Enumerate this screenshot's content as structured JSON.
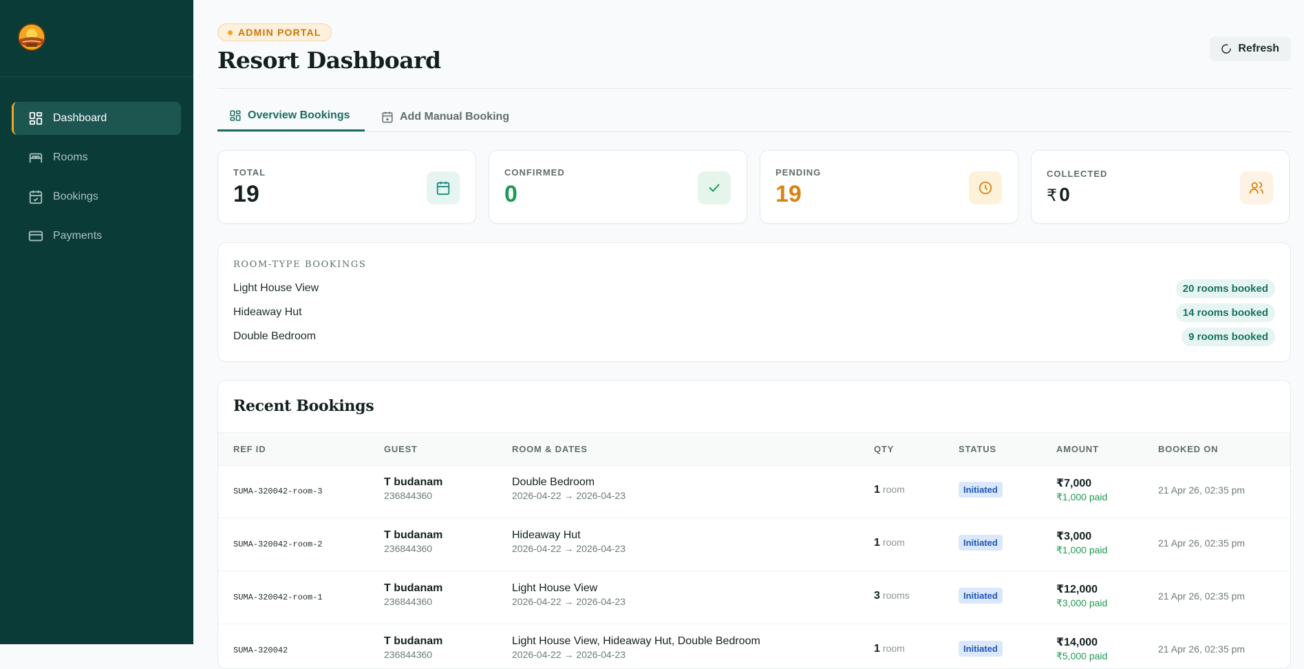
{
  "sidebar": {
    "items": [
      {
        "label": "Dashboard",
        "icon": "dashboard-icon",
        "active": true
      },
      {
        "label": "Rooms",
        "icon": "bed-icon",
        "active": false
      },
      {
        "label": "Bookings",
        "icon": "calendar-check-icon",
        "active": false
      },
      {
        "label": "Payments",
        "icon": "credit-card-icon",
        "active": false
      }
    ]
  },
  "header": {
    "badge": "ADMIN PORTAL",
    "title": "Resort Dashboard",
    "refresh_label": "Refresh"
  },
  "tabs": [
    {
      "label": "Overview Bookings",
      "active": true
    },
    {
      "label": "Add Manual Booking",
      "active": false
    }
  ],
  "stats": [
    {
      "label": "TOTAL",
      "value": "19",
      "color": "#13201f",
      "icon": "calendar-icon",
      "icon_bg": "#e6f5f1",
      "icon_color": "#1a8a7a"
    },
    {
      "label": "CONFIRMED",
      "value": "0",
      "color": "#1c9a4f",
      "icon": "check-icon",
      "icon_bg": "#e6f5ec",
      "icon_color": "#1c9a4f"
    },
    {
      "label": "PENDING",
      "value": "19",
      "color": "#d88414",
      "icon": "clock-icon",
      "icon_bg": "#fdf2d9",
      "icon_color": "#d88414"
    },
    {
      "label": "COLLECTED",
      "currency": "₹",
      "value": "0",
      "color": "#13201f",
      "icon": "users-icon",
      "icon_bg": "#fdf2e3",
      "icon_color": "#d88414"
    }
  ],
  "room_types": {
    "title": "ROOM-TYPE BOOKINGS",
    "rows": [
      {
        "name": "Light House View",
        "badge": "20 rooms booked"
      },
      {
        "name": "Hideaway Hut",
        "badge": "14 rooms booked"
      },
      {
        "name": "Double Bedroom",
        "badge": "9 rooms booked"
      }
    ]
  },
  "recent": {
    "title": "Recent Bookings",
    "columns": [
      "REF ID",
      "GUEST",
      "ROOM & DATES",
      "QTY",
      "STATUS",
      "AMOUNT",
      "BOOKED ON"
    ],
    "rows": [
      {
        "ref": "SUMA-320042-room-3",
        "guest": "T budanam",
        "phone": "236844360",
        "room": "Double Bedroom",
        "dates": "2026-04-22 → 2026-04-23",
        "qty": "1",
        "unit": "room",
        "status": "Initiated",
        "amount": "₹7,000",
        "paid": "₹1,000 paid",
        "booked_on": "21 Apr 26, 02:35 pm"
      },
      {
        "ref": "SUMA-320042-room-2",
        "guest": "T budanam",
        "phone": "236844360",
        "room": "Hideaway Hut",
        "dates": "2026-04-22 → 2026-04-23",
        "qty": "1",
        "unit": "room",
        "status": "Initiated",
        "amount": "₹3,000",
        "paid": "₹1,000 paid",
        "booked_on": "21 Apr 26, 02:35 pm"
      },
      {
        "ref": "SUMA-320042-room-1",
        "guest": "T budanam",
        "phone": "236844360",
        "room": "Light House View",
        "dates": "2026-04-22 → 2026-04-23",
        "qty": "3",
        "unit": "rooms",
        "status": "Initiated",
        "amount": "₹12,000",
        "paid": "₹3,000 paid",
        "booked_on": "21 Apr 26, 02:35 pm"
      },
      {
        "ref": "SUMA-320042",
        "guest": "T budanam",
        "phone": "236844360",
        "room": "Light House View, Hideaway Hut, Double Bedroom",
        "dates": "2026-04-22 → 2026-04-23",
        "qty": "1",
        "unit": "room",
        "status": "Initiated",
        "amount": "₹14,000",
        "paid": "₹5,000 paid",
        "booked_on": "21 Apr 26, 02:35 pm"
      }
    ]
  }
}
